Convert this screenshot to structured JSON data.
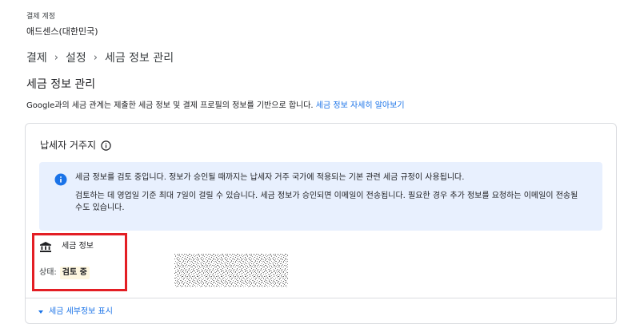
{
  "account": {
    "label": "결제 계정",
    "name": "애드센스(대한민국)"
  },
  "breadcrumb": [
    "결제",
    "설정",
    "세금 정보 관리"
  ],
  "page_title": "세금 정보 관리",
  "description": {
    "text": "Google과의 세금 관계는 제출한 세금 정보 및 결제 프로필의 정보를 기반으로 합니다.",
    "link": "세금 정보 자세히 알아보기"
  },
  "residence": {
    "title": "납세자 거주지"
  },
  "notice": {
    "line1": "세금 정보를 검토 중입니다. 정보가 승인될 때까지는 납세자 거주 국가에 적용되는 기본 관련 세금 규정이 사용됩니다.",
    "line2": "검토하는 데 영업일 기준 최대 7일이 걸릴 수 있습니다. 세금 정보가 승인되면 이메일이 전송됩니다. 필요한 경우 추가 정보를 요청하는 이메일이 전송될 수도 있습니다."
  },
  "tax_info": {
    "label": "세금 정보",
    "status_label": "상태:",
    "status_value": "검토 중"
  },
  "details_toggle": "세금 세부정보 표시",
  "colors": {
    "link": "#1a73e8",
    "notice_bg": "#e8f0fe",
    "highlight_border": "#e31e24",
    "status_bg": "#fef7e0"
  },
  "icons": {
    "residence_info": "info-outline-icon",
    "notice": "info-filled-icon",
    "tax_info": "bank-icon",
    "toggle": "caret-down-icon"
  }
}
